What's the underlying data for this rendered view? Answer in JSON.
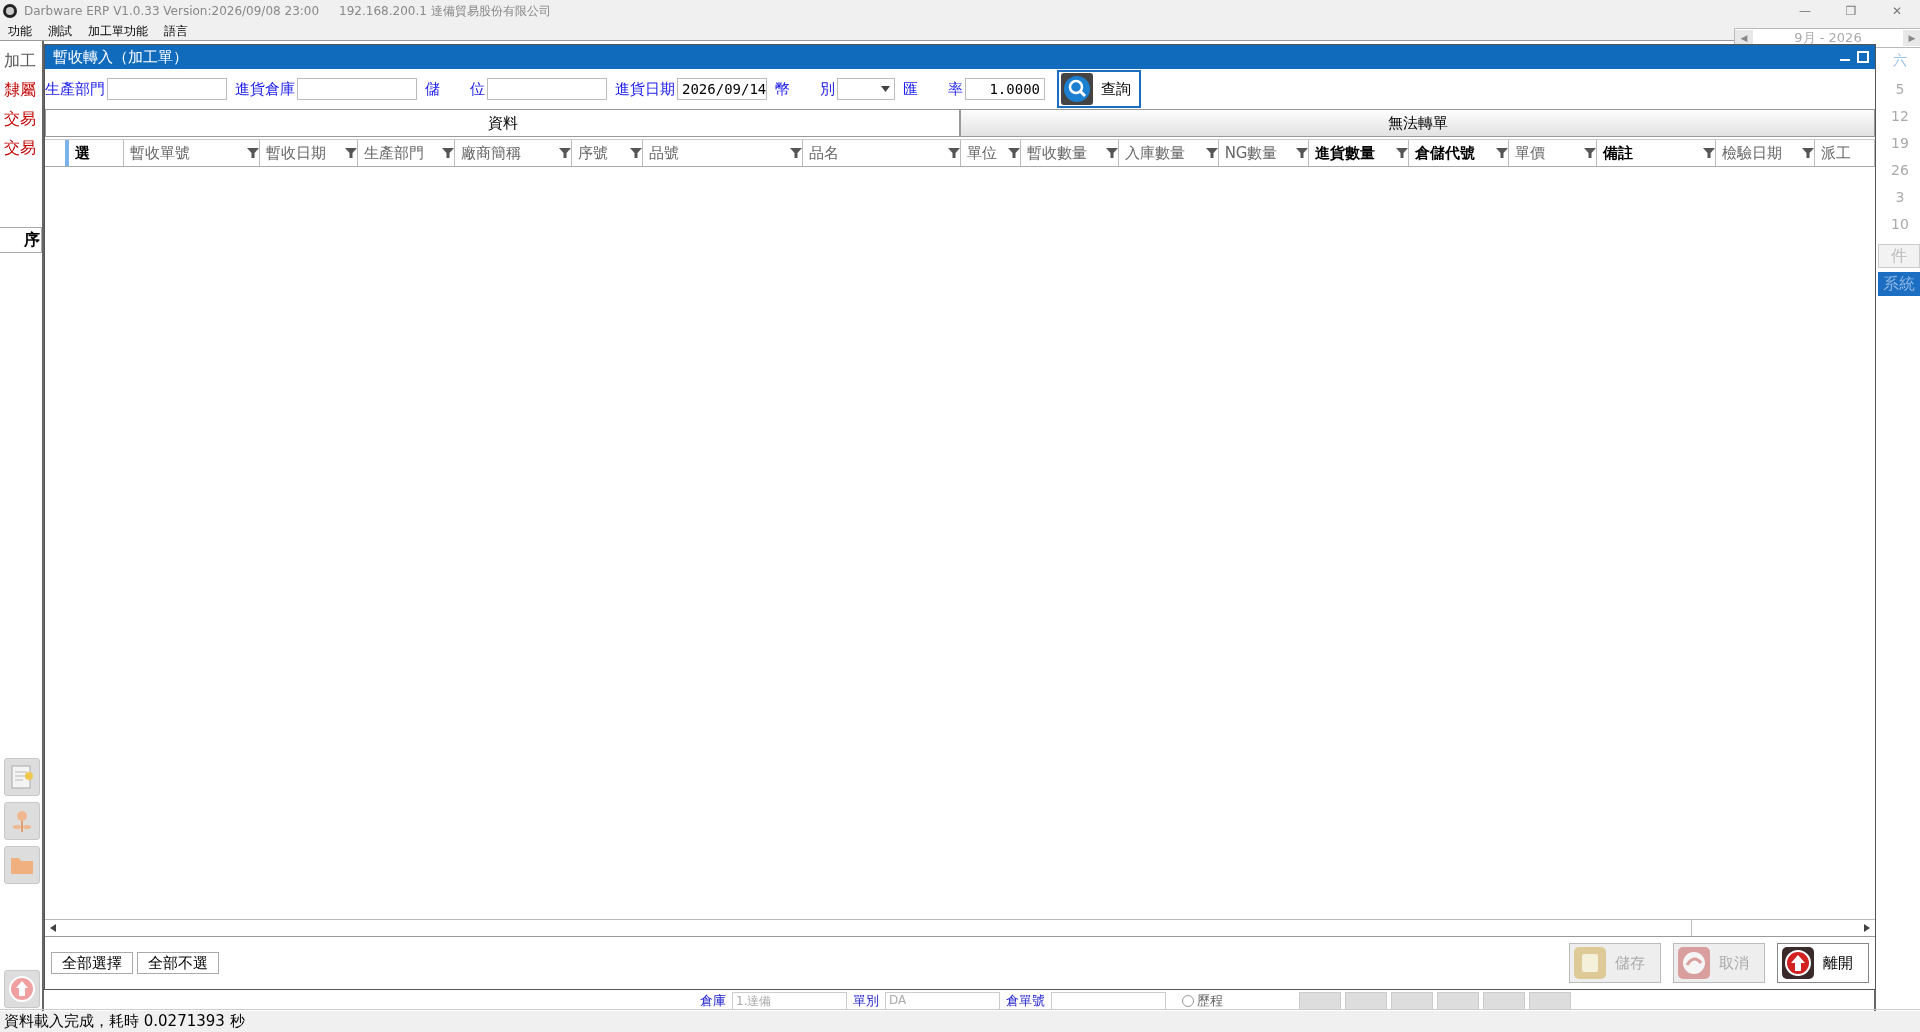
{
  "app": {
    "title": "Darbware ERP V1.0.33 Version:2026/09/08 23:00",
    "server": "192.168.200.1 達備貿易股份有限公司",
    "window_controls": [
      "—",
      "❐",
      "✕"
    ]
  },
  "menu": [
    "功能",
    "測試",
    "加工單功能",
    "語言"
  ],
  "left_panel": {
    "labels": [
      {
        "text": "加工",
        "kind": "plain"
      },
      {
        "text": "隸屬",
        "kind": "required"
      },
      {
        "text": "交易",
        "kind": "required"
      },
      {
        "text": "交易",
        "kind": "required"
      }
    ],
    "grid_header": "序"
  },
  "calendar": {
    "prev": "◀",
    "month": "9月 - 2026",
    "next": "▶",
    "weekday": "六",
    "days": [
      "5",
      "12",
      "19",
      "26",
      "3",
      "10"
    ]
  },
  "right_panel": {
    "buttons": [
      {
        "label": "件",
        "selected": false
      },
      {
        "label": "系統",
        "selected": true
      }
    ]
  },
  "background_form": {
    "fields": [
      {
        "label": "倉庫",
        "value": "1.達備"
      },
      {
        "label": "單別",
        "value": "DA"
      },
      {
        "label": "倉單號"
      }
    ],
    "radio": {
      "label": "歷程",
      "checked": false
    }
  },
  "dialog": {
    "title": "暫收轉入（加工單）",
    "filters": [
      {
        "label": "生產部門",
        "kind": "text"
      },
      {
        "label": "進貨倉庫",
        "kind": "text"
      },
      {
        "label": "儲　　位",
        "kind": "text"
      },
      {
        "label": "進貨日期",
        "value": "2026/09/14",
        "kind": "date"
      },
      {
        "label": "幣　　別",
        "kind": "select"
      },
      {
        "label": "匯　　率",
        "value": "1.0000",
        "kind": "number"
      }
    ],
    "query_button": "查詢",
    "tabs": [
      {
        "label": "資料",
        "selected": true
      },
      {
        "label": "無法轉單",
        "selected": false
      }
    ],
    "columns": [
      {
        "label": "選",
        "bold": true,
        "filter": false
      },
      {
        "label": "暫收單號",
        "bold": false,
        "filter": true
      },
      {
        "label": "暫收日期",
        "bold": false,
        "filter": true
      },
      {
        "label": "生產部門",
        "bold": false,
        "filter": true
      },
      {
        "label": "廠商簡稱",
        "bold": false,
        "filter": true
      },
      {
        "label": "序號",
        "bold": false,
        "filter": true
      },
      {
        "label": "品號",
        "bold": false,
        "filter": true
      },
      {
        "label": "品名",
        "bold": false,
        "filter": true
      },
      {
        "label": "單位",
        "bold": false,
        "filter": true
      },
      {
        "label": "暫收數量",
        "bold": false,
        "filter": true
      },
      {
        "label": "入庫數量",
        "bold": false,
        "filter": true
      },
      {
        "label": "NG數量",
        "bold": false,
        "filter": true
      },
      {
        "label": "進貨數量",
        "bold": true,
        "filter": true
      },
      {
        "label": "倉儲代號",
        "bold": true,
        "filter": true
      },
      {
        "label": "單價",
        "bold": false,
        "filter": true
      },
      {
        "label": "備註",
        "bold": true,
        "filter": true
      },
      {
        "label": "檢驗日期",
        "bold": false,
        "filter": true
      },
      {
        "label": "派工",
        "bold": false,
        "filter": false
      }
    ],
    "select_buttons": [
      "全部選擇",
      "全部不選"
    ],
    "action_buttons": [
      {
        "label": "儲存",
        "kind": "save",
        "disabled": true
      },
      {
        "label": "取消",
        "kind": "cancel",
        "disabled": true
      },
      {
        "label": "離開",
        "kind": "exit",
        "disabled": false
      }
    ]
  },
  "status_bar": "資料載入完成，耗時 0.0271393 秒"
}
